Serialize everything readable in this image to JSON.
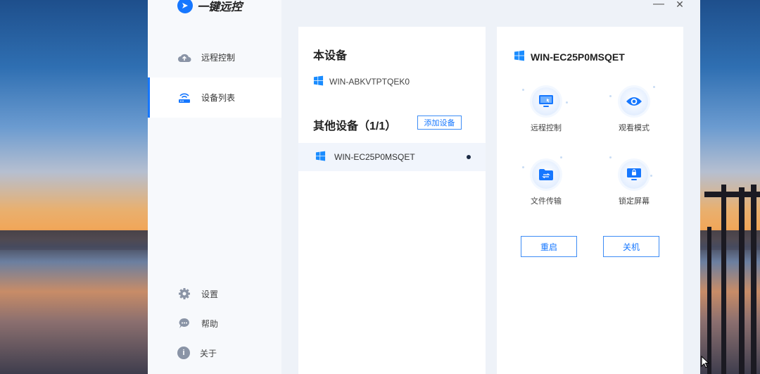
{
  "app": {
    "name": "一键远控"
  },
  "sidebar": {
    "items": [
      {
        "label": "远程控制"
      },
      {
        "label": "设备列表"
      }
    ],
    "bottom": [
      {
        "label": "设置"
      },
      {
        "label": "帮助"
      },
      {
        "label": "关于"
      }
    ]
  },
  "window_controls": {
    "minimize": "—",
    "close": "✕"
  },
  "device_list": {
    "this_device_title": "本设备",
    "this_device_name": "WIN-ABKVTPTQEK0",
    "other_devices_title": "其他设备（1/1）",
    "add_device_label": "添加设备",
    "devices": [
      {
        "name": "WIN-EC25P0MSQET",
        "online": true
      }
    ]
  },
  "detail": {
    "device_name": "WIN-EC25P0MSQET",
    "actions": [
      {
        "label": "远程控制",
        "icon": "monitor-icon"
      },
      {
        "label": "观看模式",
        "icon": "eye-icon"
      },
      {
        "label": "文件传输",
        "icon": "folder-transfer-icon"
      },
      {
        "label": "锁定屏幕",
        "icon": "lock-screen-icon"
      }
    ],
    "restart_label": "重启",
    "shutdown_label": "关机"
  },
  "colors": {
    "accent": "#1677ff",
    "windows_blue": "#1a8cff"
  }
}
